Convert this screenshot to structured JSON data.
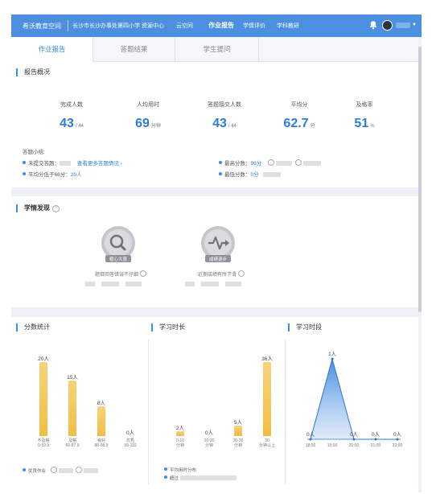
{
  "topbar": {
    "brand": "希沃教育空间",
    "school": "长沙市长沙办事处第四小学 资源中心",
    "nav": [
      "云空间",
      "作业报告",
      "学情评价",
      "学科教研"
    ],
    "active_nav": "作业报告",
    "bell_icon": "bell-icon",
    "brand_color": "#4a8fe0"
  },
  "tabs": [
    "作业报告",
    "答题结果",
    "学生提问"
  ],
  "overview": {
    "title": "报告概况",
    "stats": [
      {
        "label": "完成人数",
        "value": "43",
        "suffix": "/ 44"
      },
      {
        "label": "人均用时",
        "value": "69",
        "suffix": "分钟"
      },
      {
        "label": "答题接交人数",
        "value": "43",
        "suffix": "/ 44"
      },
      {
        "label": "平均分",
        "value": "62.7",
        "suffix": "分"
      },
      {
        "label": "及格率",
        "value": "51",
        "suffix": "%"
      }
    ],
    "summary_title": "答题小结:",
    "unsubmitted_label": "未提交答题：",
    "unsubmitted_link": "查看更多答题情况 ›",
    "below_avg_prefix": "平均分低于66分：",
    "below_avg_value": "20人",
    "highest_prefix": "最高分数：",
    "highest_value": "98分",
    "lowest_prefix": "最低分数：",
    "lowest_value": "0分"
  },
  "findings": {
    "title": "学情发现",
    "badges": [
      {
        "badge_label": "粗心大意",
        "caption": "题目回答错误不仔细"
      },
      {
        "badge_label": "成绩退步",
        "caption": "近期成绩有所下滑"
      }
    ]
  },
  "score_chart": {
    "title": "分数统计",
    "legend": "优良作业",
    "chart_data": {
      "type": "bar",
      "categories": [
        "不及格\n0-59.9",
        "及格\n60-87.9",
        "良好\n88-98.9",
        "优秀\n99-110"
      ],
      "values": [
        20,
        15,
        8,
        0
      ],
      "labels": [
        "20人",
        "15人",
        "8人",
        "0人"
      ],
      "ylim": [
        0,
        20
      ]
    }
  },
  "time_chart": {
    "title": "学习时长",
    "legend_1": "平均用时分布",
    "legend_2": "超过",
    "chart_data": {
      "type": "bar",
      "categories": [
        "0-10\n分钟",
        "10-20\n分钟",
        "20-30\n分钟",
        "30\n分钟以上"
      ],
      "values": [
        2,
        0,
        5,
        36
      ],
      "labels": [
        "2人",
        "0人",
        "5人",
        "36人"
      ],
      "ylim": [
        0,
        36
      ]
    }
  },
  "period_chart": {
    "title": "学习时段",
    "chart_data": {
      "type": "area",
      "x": [
        "18:00",
        "19:00",
        "20:00",
        "21:00",
        "22:00"
      ],
      "values": [
        0,
        1,
        0,
        0,
        0
      ],
      "labels": [
        "0人",
        "1人",
        "0人",
        "0人",
        "0人"
      ],
      "ylim": [
        0,
        1
      ]
    }
  }
}
